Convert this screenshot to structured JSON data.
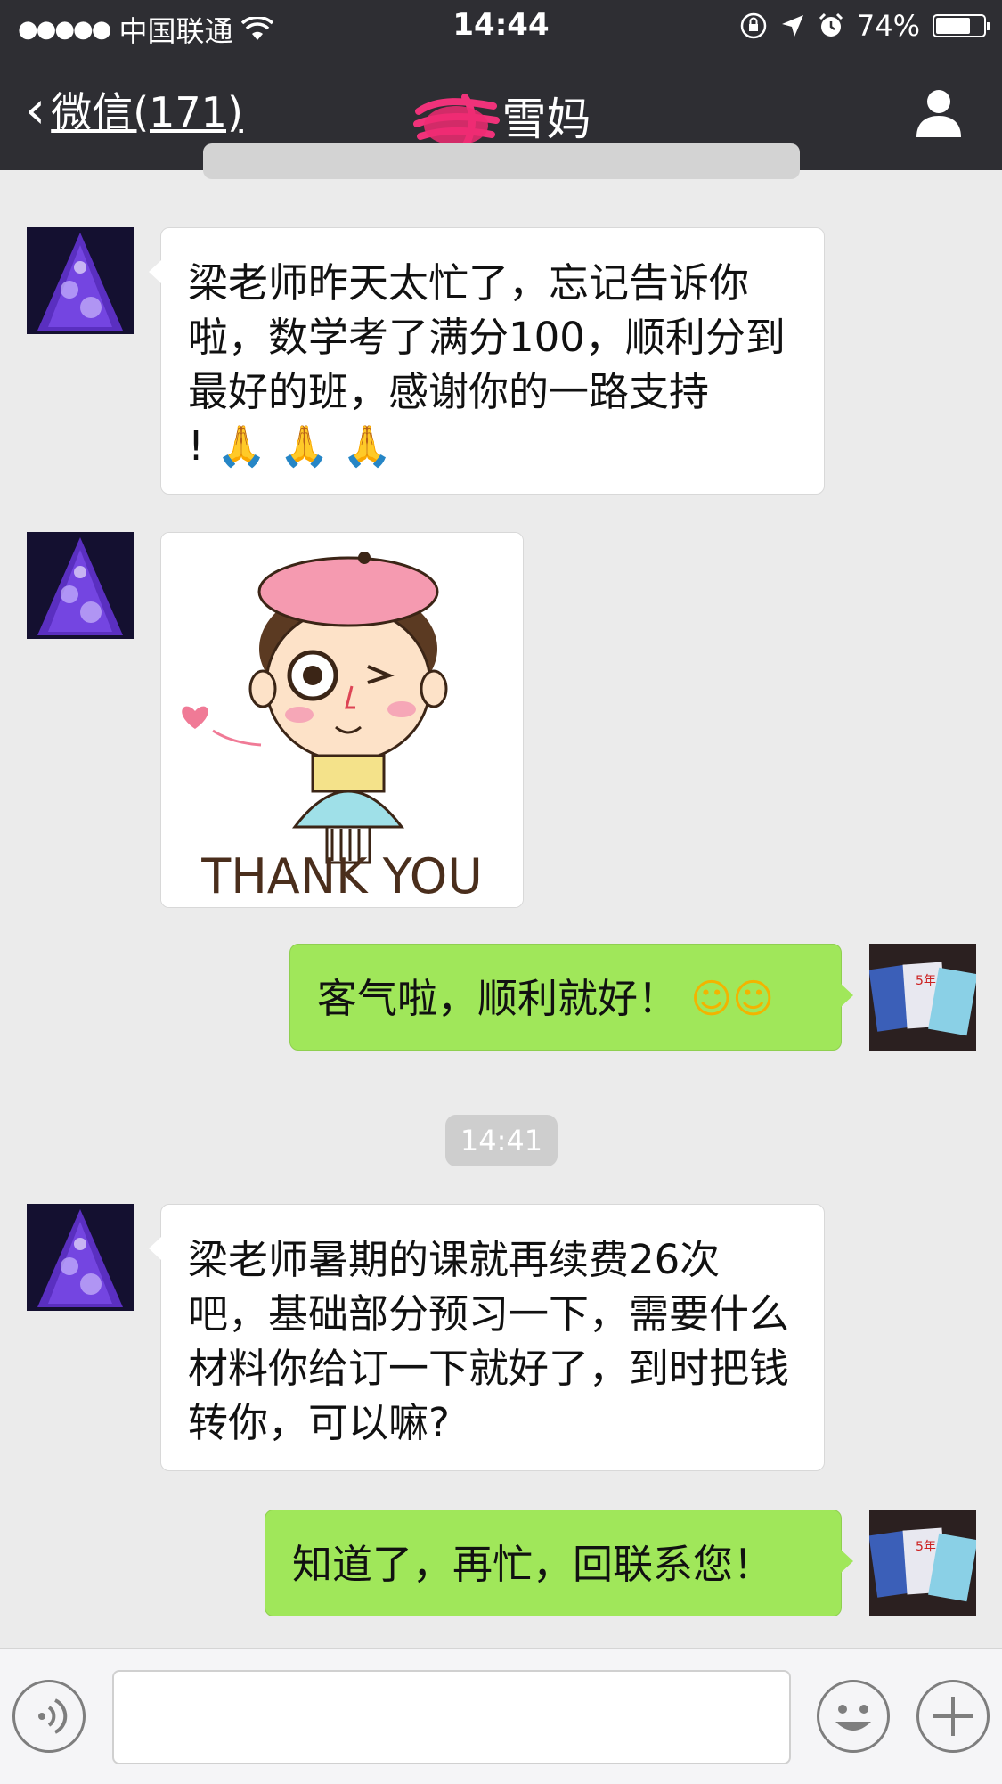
{
  "status_bar": {
    "signal_dots": "●●●●●",
    "carrier": "中国联通",
    "time": "14:44",
    "battery_percent": "74%",
    "battery_level": 0.74
  },
  "nav": {
    "back_label": "微信(171)",
    "chat_title": "雪妈"
  },
  "messages": [
    {
      "side": "in",
      "text": "梁老师昨天太忙了，忘记告诉你啦，数学考了满分100，顺利分到最好的班，感谢你的一路支持",
      "line_end": "!",
      "emoji": "🙏 🙏 🙏"
    },
    {
      "side": "in",
      "type": "sticker",
      "sticker_text": "THANK YOU"
    },
    {
      "side": "out",
      "text": "客气啦，顺利就好！",
      "emoji": "☺☺"
    },
    {
      "side": "in",
      "text": "梁老师暑期的课就再续费26次吧，基础部分预习一下，需要什么材料你给订一下就好了，到时把钱转你，可以嘛?"
    },
    {
      "side": "out",
      "text": "知道了，再忙，回联系您！"
    }
  ],
  "timestamp": "14:41",
  "colors": {
    "topbar": "#2e2e33",
    "chat_bg": "#ebebeb",
    "outgoing_bubble": "#a0e75a",
    "incoming_bubble": "#ffffff"
  }
}
